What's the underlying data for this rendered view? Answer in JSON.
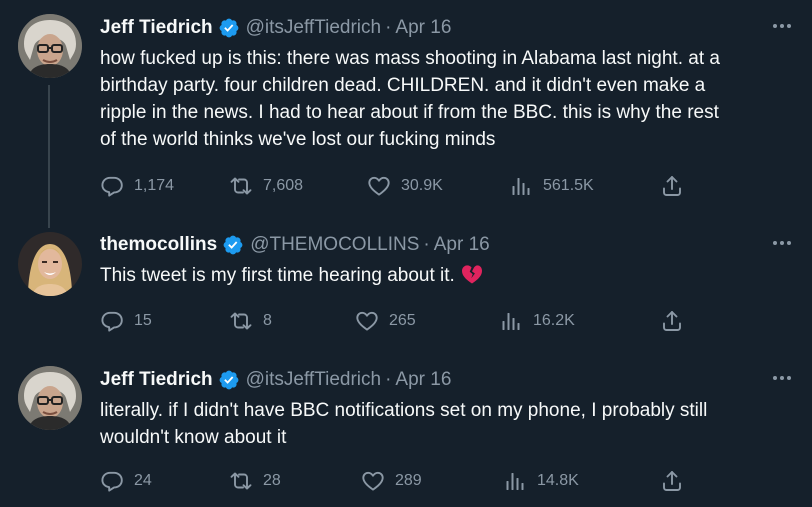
{
  "tweets": [
    {
      "display_name": "Jeff Tiedrich",
      "handle": "@itsJeffTiedrich",
      "dot": "·",
      "date": "Apr 16",
      "lines": [
        "how fucked up is this: there was mass shooting in Alabama last night. at a",
        "birthday party. four children dead. CHILDREN. and it didn't even make a",
        "ripple in the news. I had to hear about if from the BBC. this is why the rest",
        "of the world thinks we've lost our fucking minds"
      ],
      "replies": "1,174",
      "reposts": "7,608",
      "likes": "30.9K",
      "views": "561.5K"
    },
    {
      "display_name": "themocollins",
      "handle": "@THEMOCOLLINS",
      "dot": "·",
      "date": "Apr 16",
      "lines": [
        "This tweet is my first time hearing about it."
      ],
      "emoji": "broken-heart",
      "replies": "15",
      "reposts": "8",
      "likes": "265",
      "views": "16.2K"
    },
    {
      "display_name": "Jeff Tiedrich",
      "handle": "@itsJeffTiedrich",
      "dot": "·",
      "date": "Apr 16",
      "lines": [
        "literally. if I didn't have BBC notifications set on my phone, I probably still",
        "wouldn't know about it"
      ],
      "replies": "24",
      "reposts": "28",
      "likes": "289",
      "views": "14.8K"
    }
  ],
  "icons": {
    "verified": "verified-badge-icon",
    "more": "more-icon",
    "reply": "reply-icon",
    "repost": "repost-icon",
    "like": "like-icon",
    "views": "views-icon",
    "share": "share-icon"
  },
  "colors": {
    "background": "#15202b",
    "text": "#f7f9f9",
    "secondary": "#8b98a5",
    "verified": "#1d9bf0",
    "thread_line": "#38444d",
    "broken_heart": "#e0245e"
  }
}
